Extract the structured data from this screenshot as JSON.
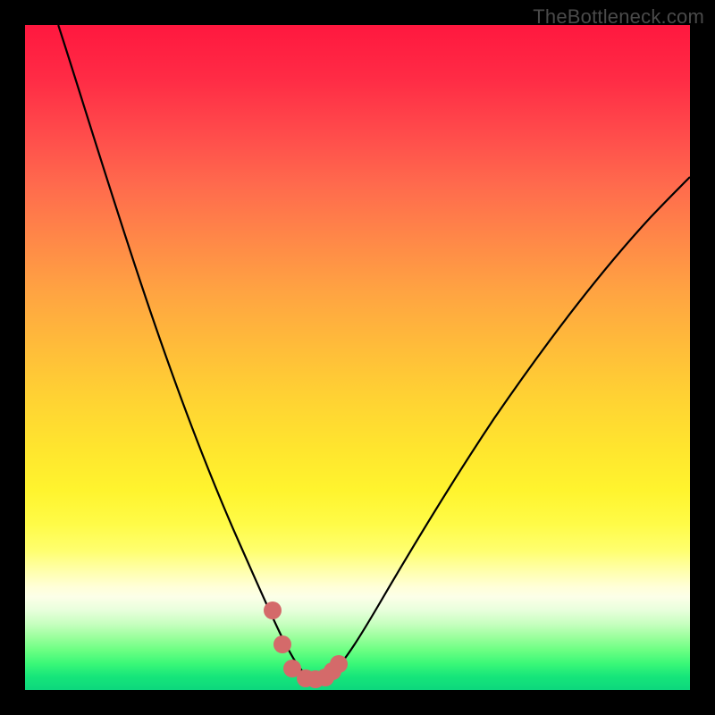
{
  "watermark": "TheBottleneck.com",
  "chart_data": {
    "type": "line",
    "title": "",
    "xlabel": "",
    "ylabel": "",
    "xlim": [
      0,
      100
    ],
    "ylim": [
      0,
      100
    ],
    "series": [
      {
        "name": "curve",
        "x": [
          5,
          10,
          15,
          20,
          25,
          30,
          33,
          35,
          37,
          38.5,
          40,
          42,
          43.5,
          45,
          47,
          50,
          55,
          60,
          65,
          70,
          75,
          80,
          85,
          90,
          95,
          99
        ],
        "y": [
          100,
          86,
          72,
          58,
          45,
          32,
          24,
          18,
          12,
          7,
          3,
          1.5,
          1.5,
          2,
          4,
          8,
          15,
          23,
          31,
          39,
          46,
          53,
          59,
          64,
          69,
          73
        ]
      }
    ],
    "markers": {
      "name": "highlight-dots",
      "color": "#d46a6a",
      "points": [
        {
          "x": 37.0,
          "y": 12.0
        },
        {
          "x": 38.5,
          "y": 7.0
        },
        {
          "x": 40.0,
          "y": 3.0
        },
        {
          "x": 42.0,
          "y": 1.5
        },
        {
          "x": 43.5,
          "y": 1.5
        },
        {
          "x": 45.0,
          "y": 2.0
        },
        {
          "x": 46.0,
          "y": 3.0
        },
        {
          "x": 47.0,
          "y": 4.0
        }
      ]
    },
    "background": "heat-gradient-red-to-green",
    "grid": false,
    "legend": false
  }
}
